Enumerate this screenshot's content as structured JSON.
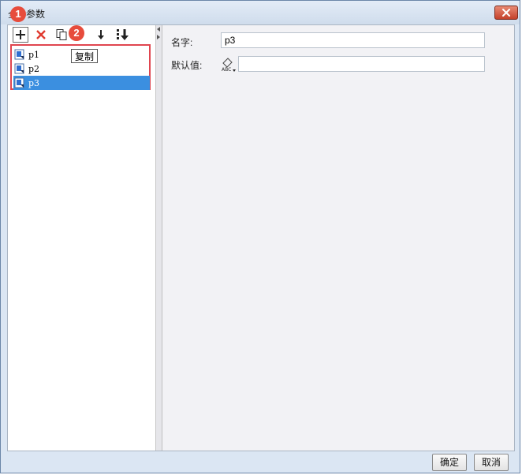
{
  "window": {
    "title_partial": "参数",
    "title_leading_glyph": "全",
    "close_label": "×"
  },
  "toolbar": {
    "tooltip": "复制",
    "icons": [
      "add-icon",
      "delete-icon",
      "copy-icon",
      "move-down-icon",
      "move-bottom-icon"
    ]
  },
  "badges": {
    "one": "1",
    "two": "2"
  },
  "params": [
    {
      "name": "p1",
      "selected": false
    },
    {
      "name": "p2",
      "selected": false
    },
    {
      "name": "p3",
      "selected": true
    }
  ],
  "form": {
    "name_label": "名字:",
    "name_value": "p3",
    "default_label": "默认值:",
    "default_value": ""
  },
  "footer": {
    "ok": "确定",
    "cancel": "取消"
  },
  "colors": {
    "selected": "#3b8fe0",
    "highlight_box": "#e0454f",
    "badge": "#e74c3c"
  }
}
